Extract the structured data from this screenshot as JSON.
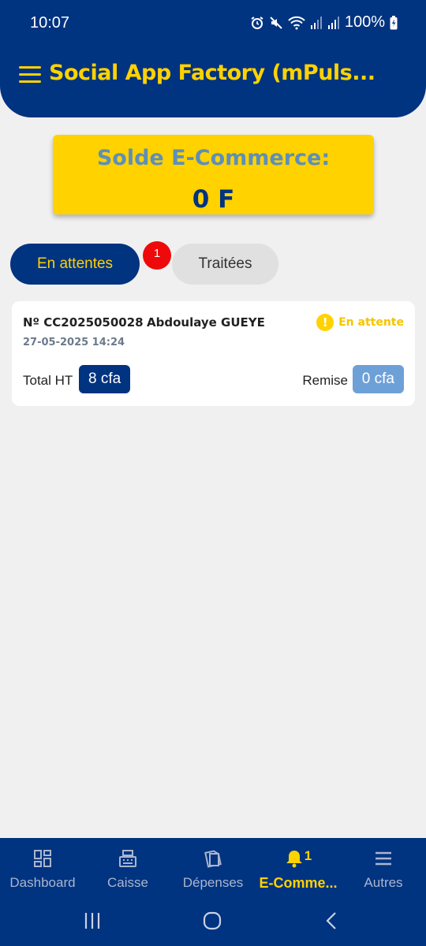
{
  "status_bar": {
    "time": "10:07",
    "battery": "100%"
  },
  "header": {
    "title": "Social App Factory (mPuls..."
  },
  "balance": {
    "label": "Solde E-Commerce:",
    "value": "0 F"
  },
  "tabs": [
    {
      "label": "En attentes",
      "active": true,
      "badge": "1"
    },
    {
      "label": "Traitées",
      "active": false
    }
  ],
  "orders": [
    {
      "number": "Nº CC2025050028",
      "customer": "Abdoulaye GUEYE",
      "date": "27-05-2025 14:24",
      "status": "En attente",
      "total_label": "Total HT",
      "total_value": "8 cfa",
      "remise_label": "Remise",
      "remise_value": "0 cfa"
    }
  ],
  "bottom_nav": [
    {
      "label": "Dashboard",
      "icon": "dashboard-icon",
      "active": false
    },
    {
      "label": "Caisse",
      "icon": "cash-register-icon",
      "active": false
    },
    {
      "label": "Dépenses",
      "icon": "expenses-icon",
      "active": false
    },
    {
      "label": "E-Comme...",
      "icon": "bell-icon",
      "active": true,
      "badge": "1"
    },
    {
      "label": "Autres",
      "icon": "menu-icon",
      "active": false
    }
  ],
  "colors": {
    "primary": "#003380",
    "accent": "#ffd200",
    "badge": "#ee0a0a",
    "remise": "#6ea0d8"
  }
}
